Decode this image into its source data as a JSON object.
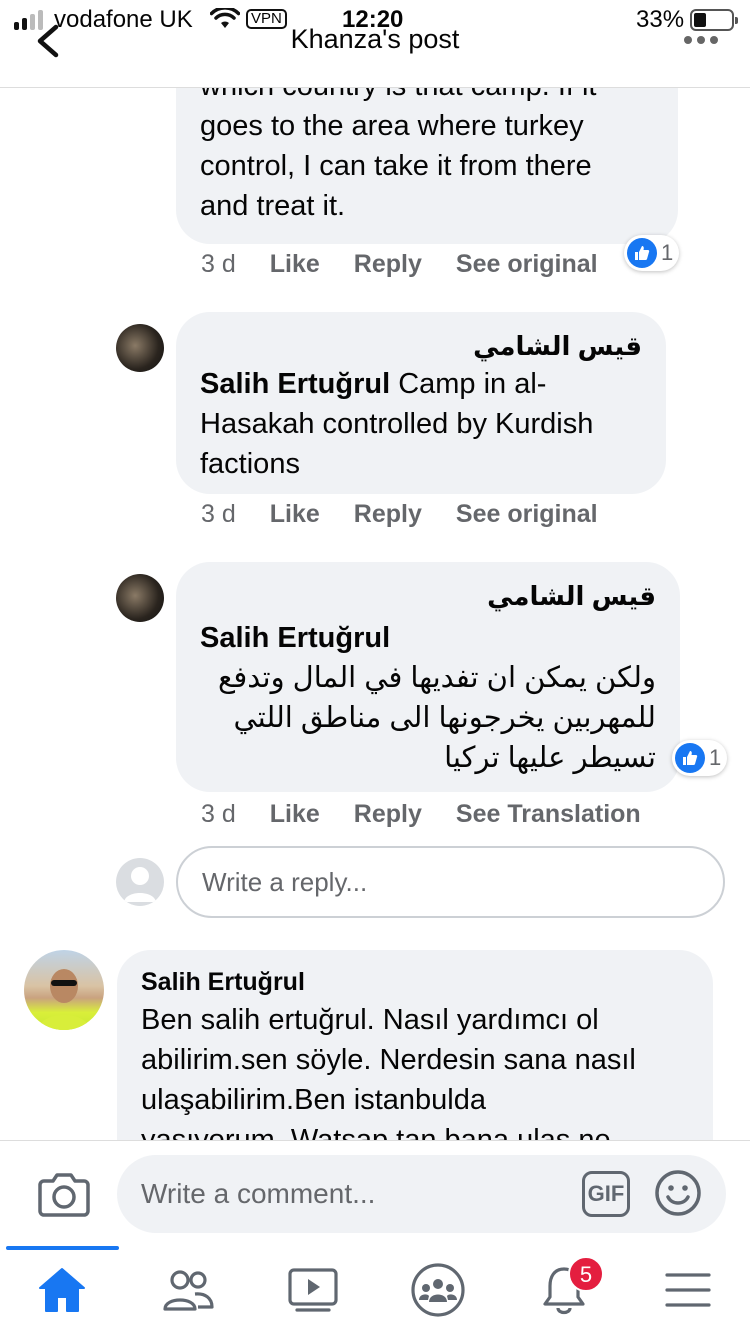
{
  "status_bar": {
    "carrier": "vodafone UK",
    "vpn": "VPN",
    "time": "12:20",
    "battery": "33%"
  },
  "header": {
    "title": "Khanza's post"
  },
  "comments": [
    {
      "text": "which country is that camp. If it goes to the area where turkey control, I can take it from there and treat it.",
      "lines": [
        "which country is that camp. If it",
        "goes to the area where turkey",
        "control, I can take it from there",
        "and treat it."
      ],
      "time": "3 d",
      "like": "Like",
      "reply": "Reply",
      "translate": "See original",
      "reactions": "1"
    },
    {
      "author": "قيس الشامي",
      "mention": "Salih Ertuğrul",
      "text_lines": [
        " Camp in al-",
        "Hasakah controlled by Kurdish",
        "factions"
      ],
      "time": "3 d",
      "like": "Like",
      "reply": "Reply",
      "translate": "See original"
    },
    {
      "author": "قيس الشامي",
      "mention": "Salih Ertuğrul",
      "arabic_lines": [
        "ولكن يمكن ان تفديها في المال وتدفع",
        "للمهربين يخرجونها الى مناطق اللتي",
        "تسيطر عليها تركيا"
      ],
      "time": "3 d",
      "like": "Like",
      "reply": "Reply",
      "translate": "See Translation",
      "reactions": "1"
    }
  ],
  "reply_box": {
    "placeholder": "Write a reply..."
  },
  "next_comment": {
    "author": "Salih Ertuğrul",
    "lines": [
      "Ben salih ertuğrul. Nasıl yardımcı ol",
      "abilirim.sen söyle. Nerdesin sana nasıl",
      "ulaşabilirim.Ben istanbulda",
      "yaşıyorum. Watsap tan bana ulaş ne"
    ]
  },
  "composer": {
    "placeholder": "Write a comment...",
    "gif": "GIF"
  },
  "tabbar": {
    "notifications_badge": "5",
    "icons": [
      "home-icon",
      "friends-icon",
      "watch-icon",
      "groups-icon",
      "bell-icon",
      "menu-icon"
    ]
  },
  "colors": {
    "accent": "#1877f2",
    "bubble": "#f0f2f5",
    "meta": "#65676b",
    "badge": "#e41e3f"
  }
}
